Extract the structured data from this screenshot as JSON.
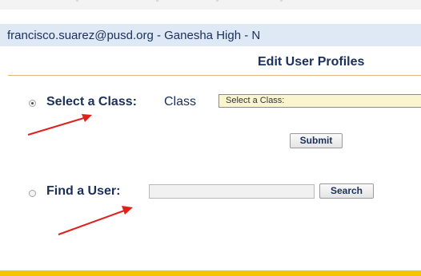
{
  "header": {
    "user_context": "francisco.suarez@pusd.org - Ganesha High - N",
    "page_title": "Edit User Profiles"
  },
  "select_class": {
    "label": "Select a Class:",
    "field_label": "Class",
    "dropdown_selected": "Select a Class:",
    "submit_label": "Submit",
    "selected": true
  },
  "find_user": {
    "label": "Find a User:",
    "input_value": "",
    "search_label": "Search",
    "selected": false
  },
  "colors": {
    "accent": "#1a2f5a",
    "user_bar_bg": "#dfe9f5",
    "dropdown_bg": "#fbf5cf",
    "annotation_arrow": "#e0201a",
    "footer_bar": "#f5c400"
  }
}
